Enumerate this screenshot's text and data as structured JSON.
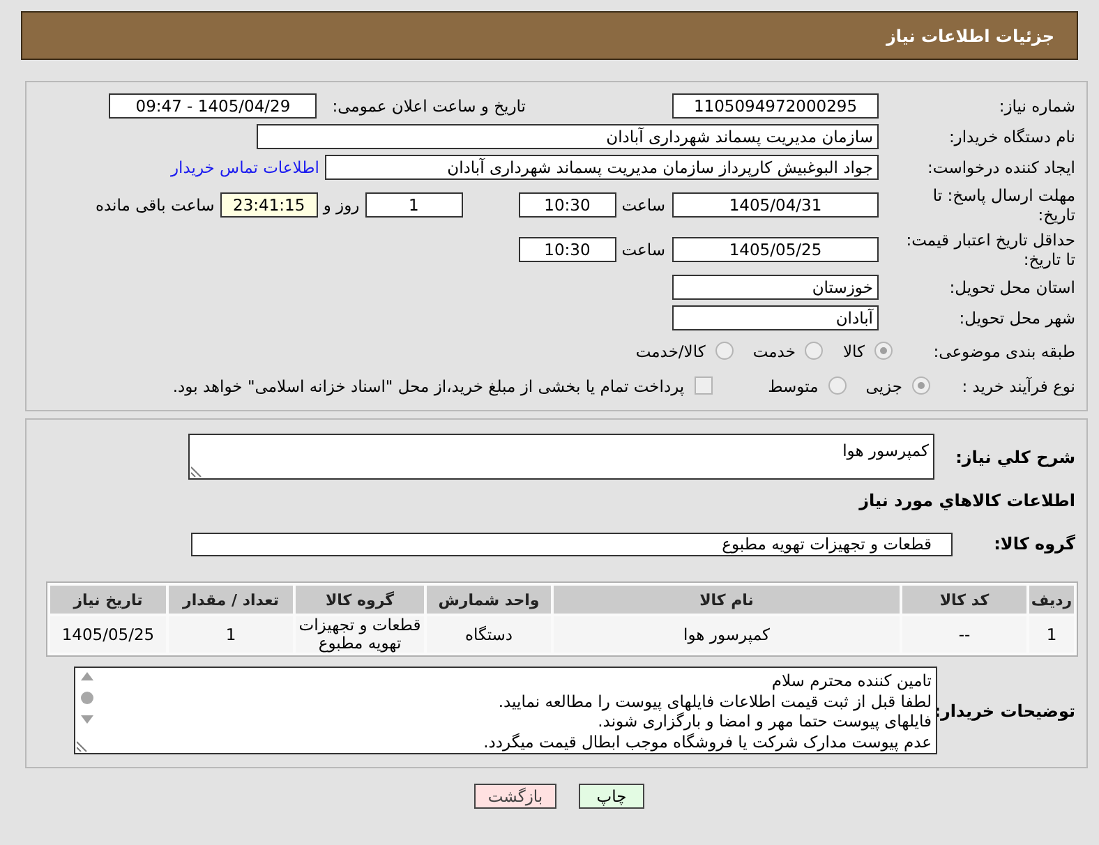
{
  "header": {
    "title": "جزئیات اطلاعات نیاز"
  },
  "details": {
    "need_number": {
      "label": "شماره نیاز:",
      "value": "1105094972000295"
    },
    "announce_datetime": {
      "label": "تاریخ و ساعت اعلان عمومی:",
      "value": "1405/04/29 - 09:47"
    },
    "buyer_org": {
      "label": "نام دستگاه خریدار:",
      "value": "سازمان مدیریت پسماند شهرداری آبادان"
    },
    "requester": {
      "label": "ایجاد کننده درخواست:",
      "value": "جواد البوغبیش کارپرداز سازمان مدیریت پسماند شهرداری آبادان",
      "link": "اطلاعات تماس خریدار"
    },
    "response_deadline": {
      "label": "مهلت ارسال پاسخ: تا تاریخ:",
      "date": "1405/04/31",
      "time_label": "ساعت",
      "time": "10:30",
      "days": "1",
      "days_label": "روز و",
      "remaining": "23:41:15",
      "remaining_label": "ساعت باقی مانده"
    },
    "price_validity": {
      "label": "حداقل تاریخ اعتبار قیمت: تا تاریخ:",
      "date": "1405/05/25",
      "time_label": "ساعت",
      "time": "10:30"
    },
    "province": {
      "label": "استان محل تحویل:",
      "value": "خوزستان"
    },
    "city": {
      "label": "شهر محل تحویل:",
      "value": "آبادان"
    },
    "category": {
      "label": "طبقه بندی موضوعی:",
      "options": [
        {
          "label": "کالا",
          "selected": true
        },
        {
          "label": "خدمت",
          "selected": false
        },
        {
          "label": "کالا/خدمت",
          "selected": false
        }
      ]
    },
    "purchase_type": {
      "label": "نوع فرآیند خرید :",
      "options": [
        {
          "label": "جزیی",
          "selected": true
        },
        {
          "label": "متوسط",
          "selected": false
        }
      ],
      "treasury_payment": {
        "label": "پرداخت تمام یا بخشی از مبلغ خرید،از محل \"اسناد خزانه اسلامی\" خواهد بود.",
        "checked": false
      }
    }
  },
  "description": {
    "label": "شرح کلي نياز:",
    "value": "کمپرسور هوا"
  },
  "items_section": {
    "title": "اطلاعات کالاهاي مورد نياز",
    "group": {
      "label": "گروه کالا:",
      "value": "قطعات و تجهیزات تهویه مطبوع"
    },
    "table": {
      "columns": [
        "ردیف",
        "کد کالا",
        "نام کالا",
        "واحد شمارش",
        "گروه کالا",
        "تعداد / مقدار",
        "تاریخ نیاز"
      ],
      "rows": [
        [
          "1",
          "--",
          "کمپرسور هوا",
          "دستگاه",
          "قطعات و تجهیزات تهویه مطبوع",
          "1",
          "1405/05/25"
        ]
      ]
    }
  },
  "buyer_notes": {
    "label": "توضیحات خریدار:",
    "lines": [
      "تامین کننده محترم سلام",
      "لطفا قبل از ثبت قیمت اطلاعات فایلهای پیوست را مطالعه نمایید.",
      "فایلهای پیوست حتما مهر و امضا و بارگزاری شوند.",
      "عدم پیوست مدارک شرکت یا فروشگاه موجب ابطال قیمت میگردد."
    ]
  },
  "buttons": [
    {
      "label": "چاپ",
      "kind": "print"
    },
    {
      "label": "بازگشت",
      "kind": "back"
    }
  ]
}
